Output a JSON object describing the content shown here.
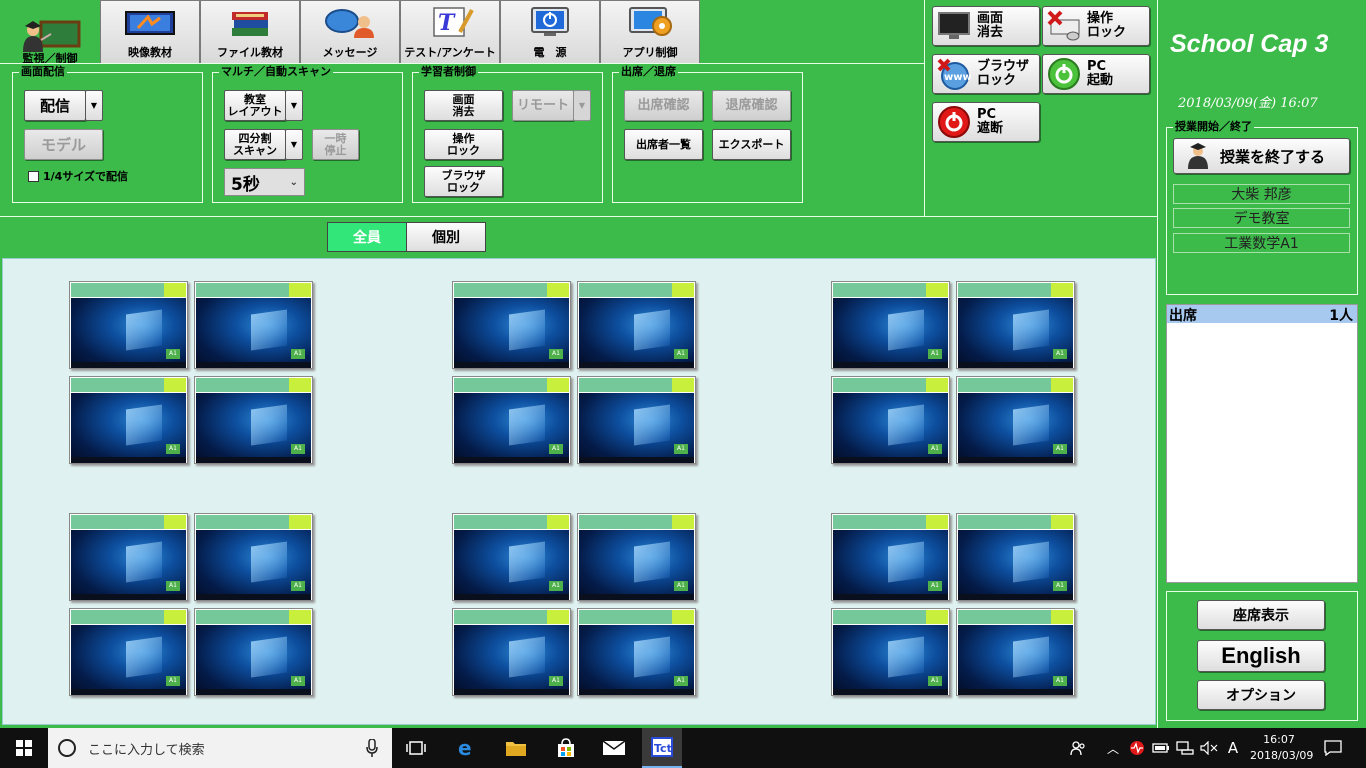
{
  "tabs": [
    {
      "label": "監視／制御",
      "icon": "teacher-icon"
    },
    {
      "label": "映像教材",
      "icon": "video-icon"
    },
    {
      "label": "ファイル教材",
      "icon": "books-icon"
    },
    {
      "label": "メッセージ",
      "icon": "message-icon"
    },
    {
      "label": "テスト/アンケート",
      "icon": "test-icon"
    },
    {
      "label": "電　源",
      "icon": "power-icon"
    },
    {
      "label": "アプリ制御",
      "icon": "app-control-icon"
    }
  ],
  "groups": {
    "screen_delivery": {
      "title": "画面配信",
      "deliver_label": "配信",
      "model_label": "モデル",
      "quarter_size_label": "1/4サイズで配信"
    },
    "multi_scan": {
      "title": "マルチ／自動スキャン",
      "layout_label": "教室\nレイアウト",
      "quad_scan_label": "四分割\nスキャン",
      "pause_label": "一時\n停止",
      "interval_value": "5秒"
    },
    "learner_control": {
      "title": "学習者制御",
      "clear_screen_label": "画面\n消去",
      "remote_label": "リモート",
      "op_lock_label": "操作\nロック",
      "browser_lock_label": "ブラウザ\nロック"
    },
    "attendance": {
      "title": "出席／退席",
      "check_in_label": "出席確認",
      "check_out_label": "退席確認",
      "attendee_list_label": "出席者一覧",
      "export_label": "エクスポート"
    }
  },
  "quick_buttons": {
    "clear_screen": "画面\n消去",
    "op_lock": "操作\nロック",
    "browser_lock": "ブラウザ\nロック",
    "pc_start": "PC\n起動",
    "pc_shutdown": "PC\n遮断"
  },
  "sidebar": {
    "app_title": "School Cap 3",
    "datetime": "2018/03/09(金) 16:07",
    "class_box_title": "授業開始／終了",
    "end_class_label": "授業を終了する",
    "teacher_name": "大柴 邦彦",
    "classroom": "デモ教室",
    "course": "工業数学A1",
    "attendance_label": "出席",
    "attendance_count": "1人",
    "seat_view_label": "座席表示",
    "language_label": "English",
    "options_label": "オプション"
  },
  "mode_toggle": {
    "all_label": "全員",
    "individual_label": "個別"
  },
  "seat_badge": "A1",
  "taskbar": {
    "search_placeholder": "ここに入力して検索",
    "time": "16:07",
    "date": "2018/03/09",
    "ime": "A"
  },
  "colors": {
    "panel_green": "#3cba4a",
    "seat_area_bg": "#dff2f1",
    "toggle_on": "#33e67a",
    "attendance_row": "#a8c9ef"
  }
}
